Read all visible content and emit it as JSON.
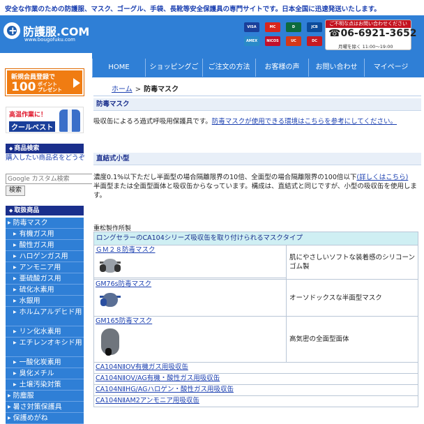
{
  "topbar": {
    "tagline": "安全な作業のための防護服、マスク、ゴーグル、手袋、長靴等安全保護具の専門サイトです。日本全国に迅速発送いたします。"
  },
  "header": {
    "logo_name": "防護服.COM",
    "logo_domain": "www.bougofuku.com",
    "cards": [
      {
        "label": "VISA",
        "color": "#1a3f9a"
      },
      {
        "label": "MC",
        "color": "#d8261c"
      },
      {
        "label": "D",
        "color": "#0d6b3d"
      },
      {
        "label": "JCB",
        "color": "#0c4b9a"
      },
      {
        "label": "AMEX",
        "color": "#2a8ac8"
      },
      {
        "label": "NICOS",
        "color": "#c2102a"
      },
      {
        "label": "UC",
        "color": "#d43818"
      },
      {
        "label": "DC",
        "color": "#c61a22"
      }
    ],
    "contact_caption": "ご不明な点はお問い合わせください",
    "tel": "☎06-6921-3652",
    "hours": "月曜を除く 11:00〜19:00"
  },
  "nav": {
    "items": [
      "HOME",
      "ショッピングご",
      "ご注文の方法",
      "お客様の声",
      "お問い合わせ",
      "マイページ"
    ]
  },
  "sidebar": {
    "promo1": {
      "line1": "新規会員登録で",
      "big": "100",
      "small1": "ポイント",
      "small2": "プレゼント"
    },
    "promo2": {
      "line1": "高温作業に！",
      "line2": "クールベスト"
    },
    "search_heading": "商品検索",
    "search_note": "購入したい商品名をどうぞ",
    "search_placeholder": "Google カスタム検索",
    "search_button": "検索",
    "category_heading": "取扱商品",
    "categories": [
      {
        "label": "防毒マスク",
        "level": "top"
      },
      {
        "label": "有機ガス用",
        "level": "sub"
      },
      {
        "label": "酸性ガス用",
        "level": "sub"
      },
      {
        "label": "ハロゲンガス用",
        "level": "sub"
      },
      {
        "label": "アンモニア用",
        "level": "sub"
      },
      {
        "label": "亜硫酸ガス用",
        "level": "sub"
      },
      {
        "label": "硫化水素用",
        "level": "sub"
      },
      {
        "label": "水銀用",
        "level": "sub"
      },
      {
        "label": "ホルムアルデヒド用",
        "level": "sub2"
      },
      {
        "label": "リン化水素用",
        "level": "sub"
      },
      {
        "label": "エチレンオキシド用",
        "level": "sub2"
      },
      {
        "label": "一酸化炭素用",
        "level": "sub"
      },
      {
        "label": "臭化メチル",
        "level": "sub"
      },
      {
        "label": "土壌汚染対策",
        "level": "sub"
      },
      {
        "label": "防塵服",
        "level": "top"
      },
      {
        "label": "暑さ対策保護具",
        "level": "top"
      },
      {
        "label": "保護めがね",
        "level": "top"
      }
    ]
  },
  "breadcrumb": {
    "home": "ホーム",
    "sep": ">",
    "current": "防毒マスク"
  },
  "main": {
    "section1_title": "防毒マスク",
    "section1_text": "吸収缶によるろ過式呼吸用保護具です。",
    "section1_link": "防毒マスクが使用できる環境はこちらを参考にしてください。",
    "section2_title": "直結式小型",
    "section2_text1": "濃度0.1%以下ただし半面型の場合隔離限界の10倍、全面型の場合隔離限界の100倍以下",
    "section2_link": "(詳しくはこちら)",
    "section2_text2": "半面型または全面型面体と吸収缶からなっています。構成は、直結式と同じですが、小型の吸収缶を使用します。",
    "maker": "重松製作所製",
    "table_caption": "ロングセラーのCA104シリーズ吸収缶を取り付けられるマスクタイプ",
    "products": [
      {
        "name": "ＧＭ２８防毒マスク",
        "desc": "肌にやさしいソフトな装着感のシリコーンゴム製"
      },
      {
        "name": "GM76s防毒マスク",
        "desc": "オーソドックスな半面型マスク"
      },
      {
        "name": "GM165防毒マスク",
        "desc": "高気密の全面型面体"
      }
    ],
    "absorbers": [
      "CA104NⅡOV有機ガス用吸収缶",
      "CA104NⅡOV/AG有機・酸性ガス用吸収缶",
      "CA104NⅡHG/AGハロゲン・酸性ガス用吸収缶",
      "CA104NⅡAM2アンモニア用吸収缶"
    ]
  }
}
